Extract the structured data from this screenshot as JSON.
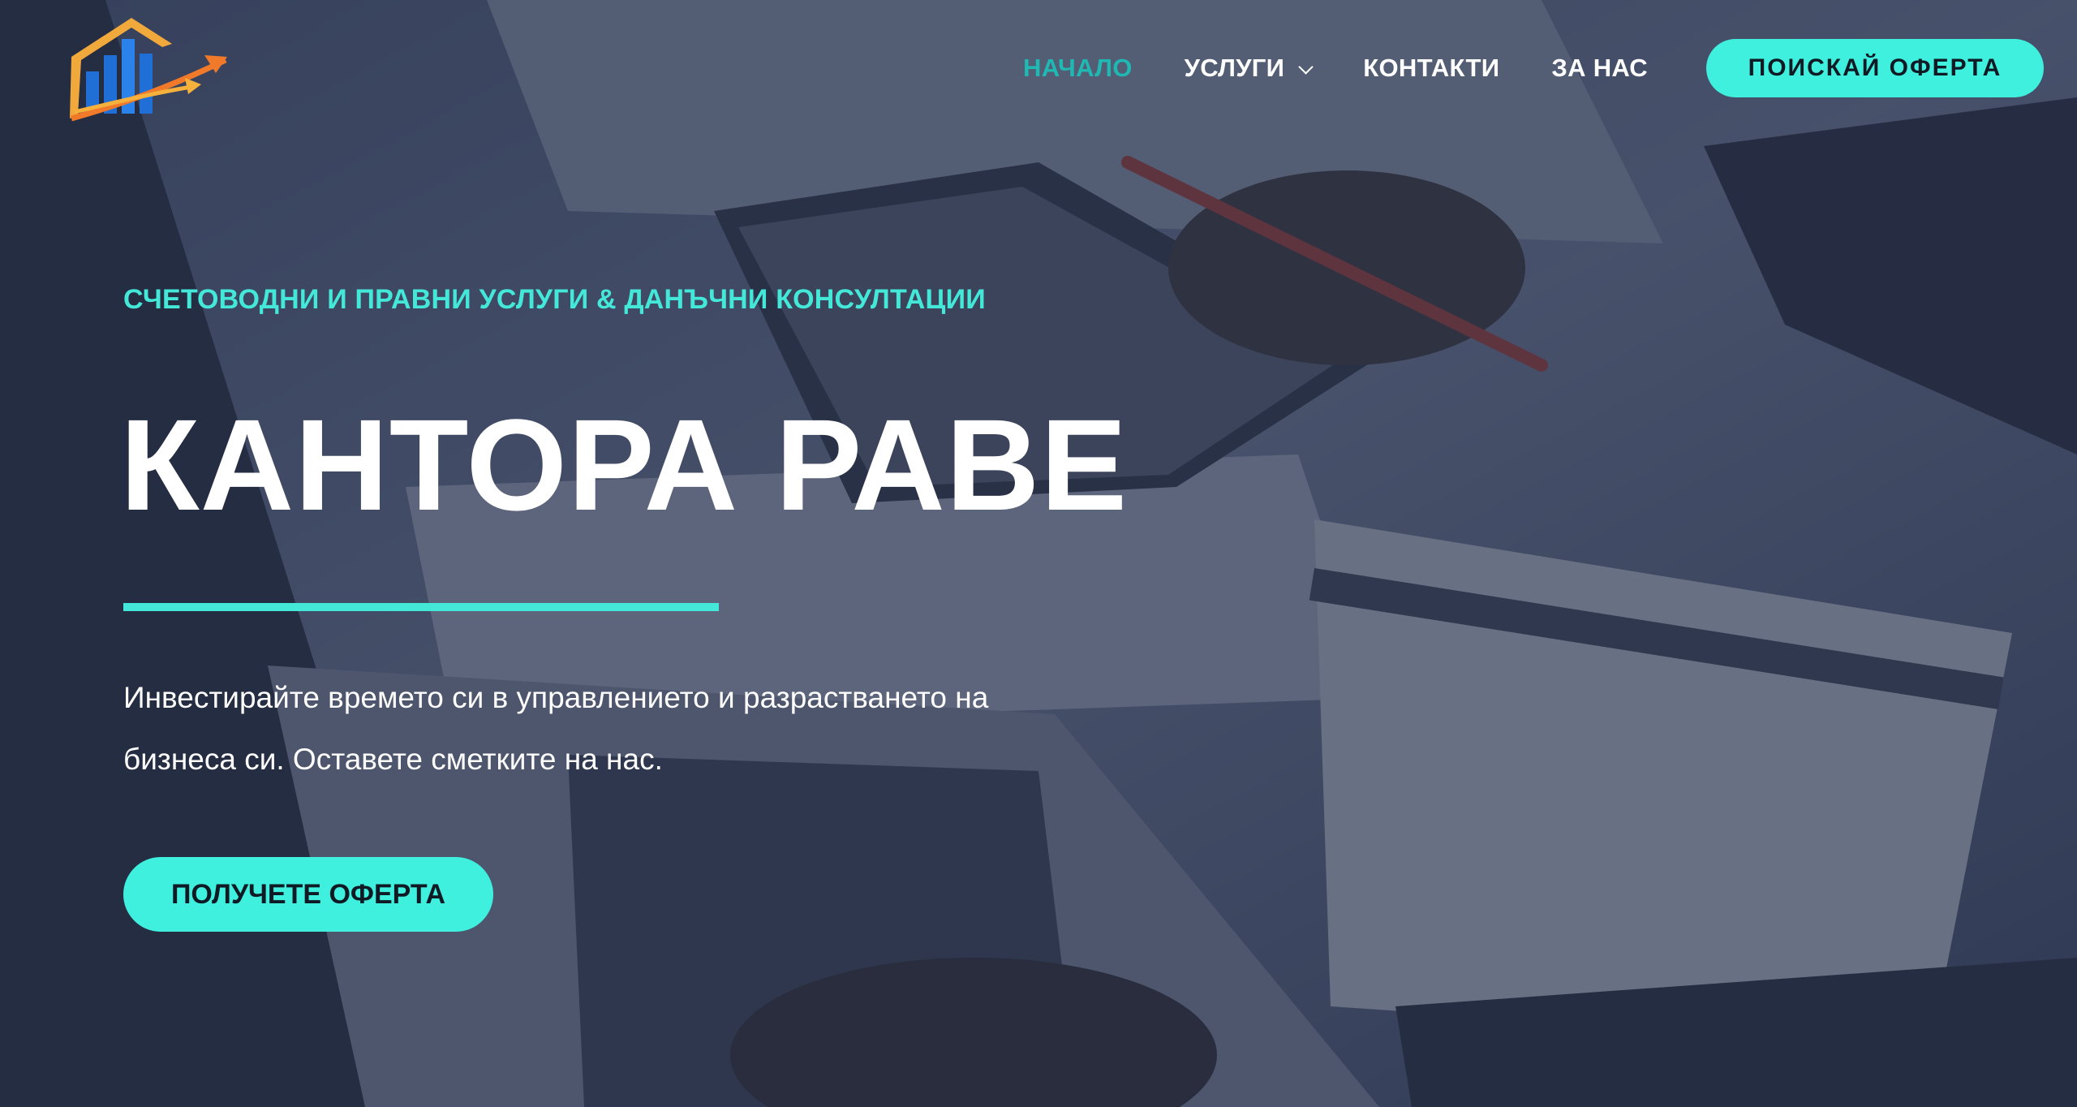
{
  "header": {
    "logo_name": "chart-arrow-logo",
    "nav": [
      {
        "label": "НАЧАЛО",
        "active": true
      },
      {
        "label": "УСЛУГИ",
        "has_dropdown": true
      },
      {
        "label": "КОНТАКТИ"
      },
      {
        "label": "ЗА НАС"
      }
    ],
    "cta_label": "ПОИСКАЙ ОФЕРТА"
  },
  "hero": {
    "eyebrow": "СЧЕТОВОДНИ И ПРАВНИ УСЛУГИ & ДАНЪЧНИ КОНСУЛТАЦИИ",
    "title": "КАНТОРА РАВЕ",
    "lede_line1": "Инвестирайте времето си в управлението и разрастването на",
    "lede_line2": "бизнеса си. Оставете сметките на нас.",
    "cta_label": "ПОЛУЧЕТЕ ОФЕРТА"
  },
  "colors": {
    "accent": "#3ff0df",
    "nav_active": "#1fb8b3",
    "overlay": "#263048"
  }
}
